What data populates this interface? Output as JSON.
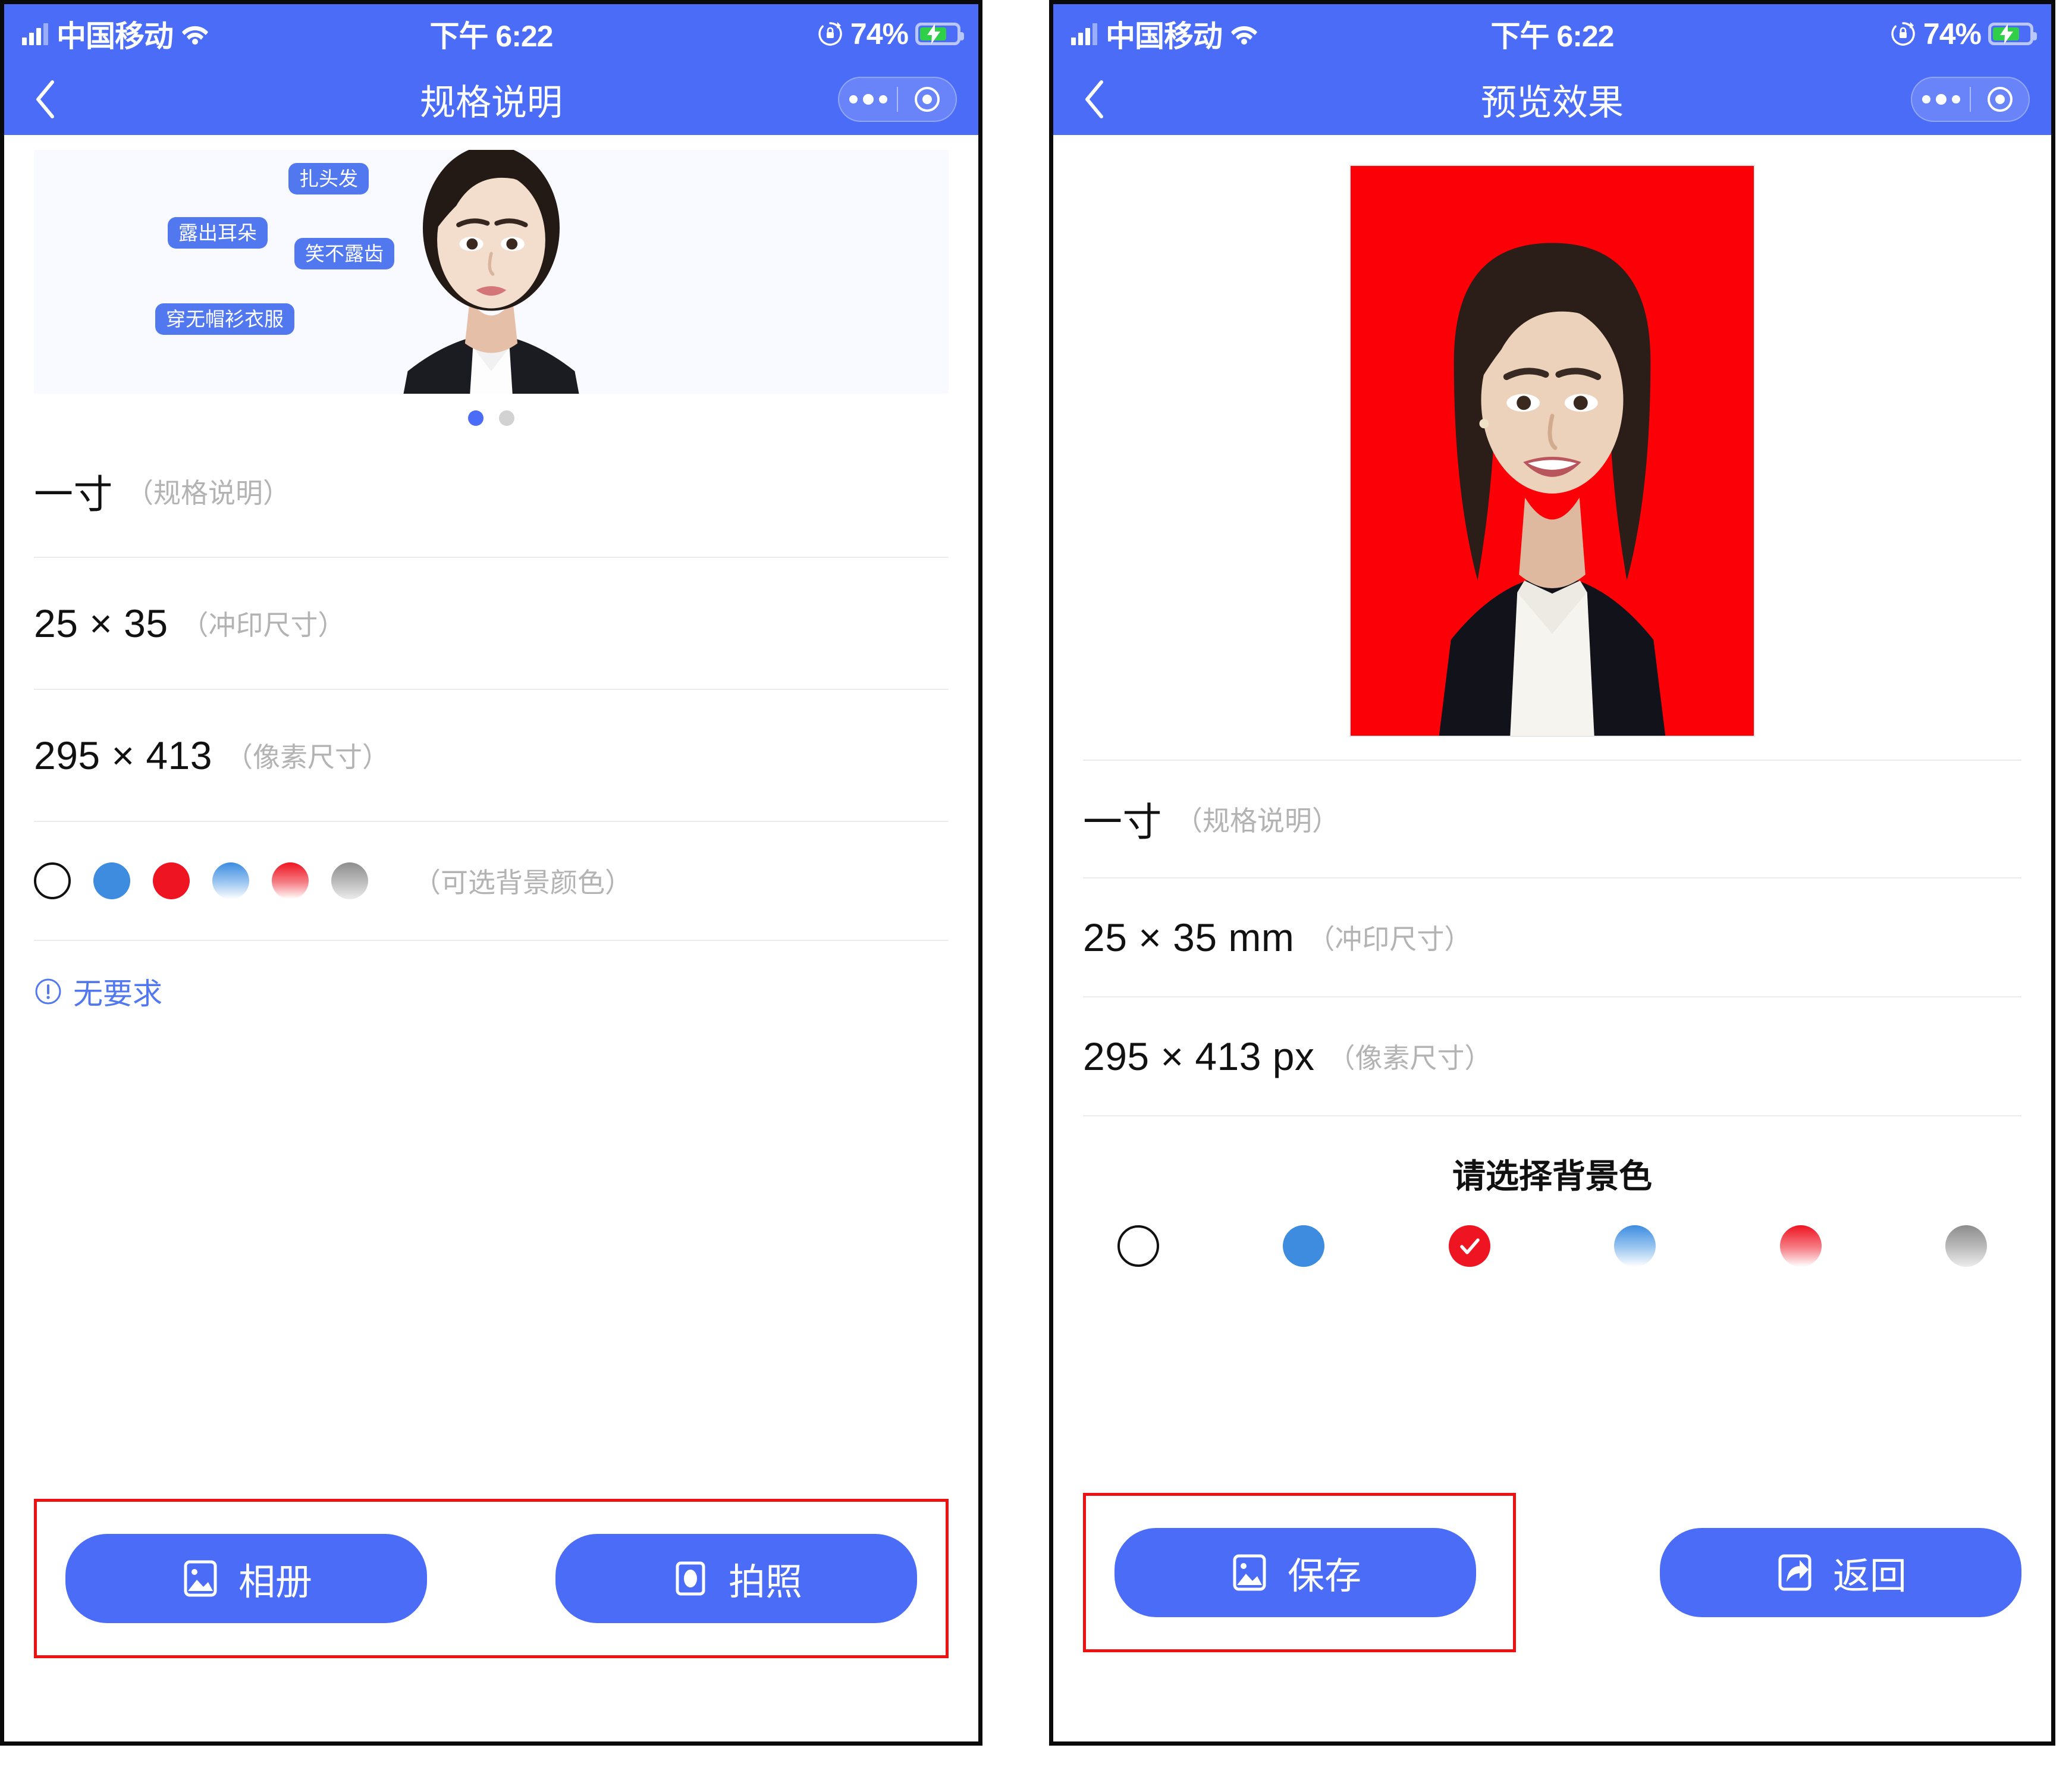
{
  "status_bar": {
    "carrier": "中国移动",
    "time": "下午 6:22",
    "battery_percent": "74%",
    "battery_level": 74,
    "signal_icon": "signal-bars-icon",
    "wifi_icon": "wifi-icon",
    "lock_rotation_icon": "rotation-lock-icon",
    "battery_icon": "battery-charging-icon"
  },
  "left_screen": {
    "nav": {
      "back_icon": "chevron-left-icon",
      "title": "规格说明",
      "menu_icon": "more-dots-icon",
      "target_icon": "mini-program-target-icon"
    },
    "banner": {
      "alt": "证件照示范照片",
      "tags": [
        "扎头发",
        "露出耳朵",
        "笑不露齿",
        "穿无帽衫衣服"
      ],
      "pager": {
        "total": 2,
        "active": 1
      }
    },
    "specs": [
      {
        "value": "一寸",
        "label": "（规格说明）"
      },
      {
        "value": "25 × 35",
        "label": "（冲印尺寸）"
      },
      {
        "value": "295 × 413",
        "label": "（像素尺寸）"
      }
    ],
    "swatch_label": "（可选背景颜色）",
    "swatches": [
      {
        "name": "white",
        "color": "#ffffff",
        "kind": "solid",
        "selected": false
      },
      {
        "name": "blue",
        "color": "#3d8ce0",
        "kind": "solid",
        "selected": false
      },
      {
        "name": "red",
        "color": "#ef1421",
        "kind": "solid",
        "selected": false
      },
      {
        "name": "blue-grad",
        "color": "#3d8ce0",
        "kind": "gradient",
        "selected": false
      },
      {
        "name": "red-grad",
        "color": "#ef1421",
        "kind": "gradient",
        "selected": false
      },
      {
        "name": "gray-grad",
        "color": "#8d8d8d",
        "kind": "gradient",
        "selected": false
      }
    ],
    "note": {
      "icon": "info-circle-icon",
      "text": "无要求",
      "color": "#5278f0"
    },
    "buttons": [
      {
        "name": "album",
        "label": "相册",
        "icon": "photo-icon"
      },
      {
        "name": "camera",
        "label": "拍照",
        "icon": "camera-icon"
      }
    ],
    "highlight_box_color": "#ee1111"
  },
  "right_screen": {
    "nav": {
      "back_icon": "chevron-left-icon",
      "title": "预览效果",
      "menu_icon": "more-dots-icon",
      "target_icon": "mini-program-target-icon"
    },
    "preview": {
      "alt": "红底证件照预览",
      "background_color": "#fc0007"
    },
    "specs": [
      {
        "value": "一寸",
        "label": "（规格说明）"
      },
      {
        "value": "25 × 35 mm",
        "label": "（冲印尺寸）"
      },
      {
        "value": "295 × 413 px",
        "label": "（像素尺寸）"
      }
    ],
    "select_title": "请选择背景色",
    "swatches": [
      {
        "name": "white",
        "color": "#ffffff",
        "kind": "solid",
        "selected": false
      },
      {
        "name": "blue",
        "color": "#3d8ce0",
        "kind": "solid",
        "selected": false
      },
      {
        "name": "red",
        "color": "#ef1421",
        "kind": "solid",
        "selected": true
      },
      {
        "name": "blue-grad",
        "color": "#3d8ce0",
        "kind": "gradient",
        "selected": false
      },
      {
        "name": "red-grad",
        "color": "#ef1421",
        "kind": "gradient",
        "selected": false
      },
      {
        "name": "gray-grad",
        "color": "#8d8d8d",
        "kind": "gradient",
        "selected": false
      }
    ],
    "buttons": [
      {
        "name": "save",
        "label": "保存",
        "icon": "photo-icon"
      },
      {
        "name": "back",
        "label": "返回",
        "icon": "share-arrow-icon"
      }
    ],
    "highlight_box_color": "#ee1111"
  },
  "theme": {
    "brand_blue": "#4a6cf7",
    "tag_blue": "#5278f0",
    "divider": "#ebebeb",
    "muted_text": "#b3b3b3",
    "photo_bg": "#f8faff"
  }
}
